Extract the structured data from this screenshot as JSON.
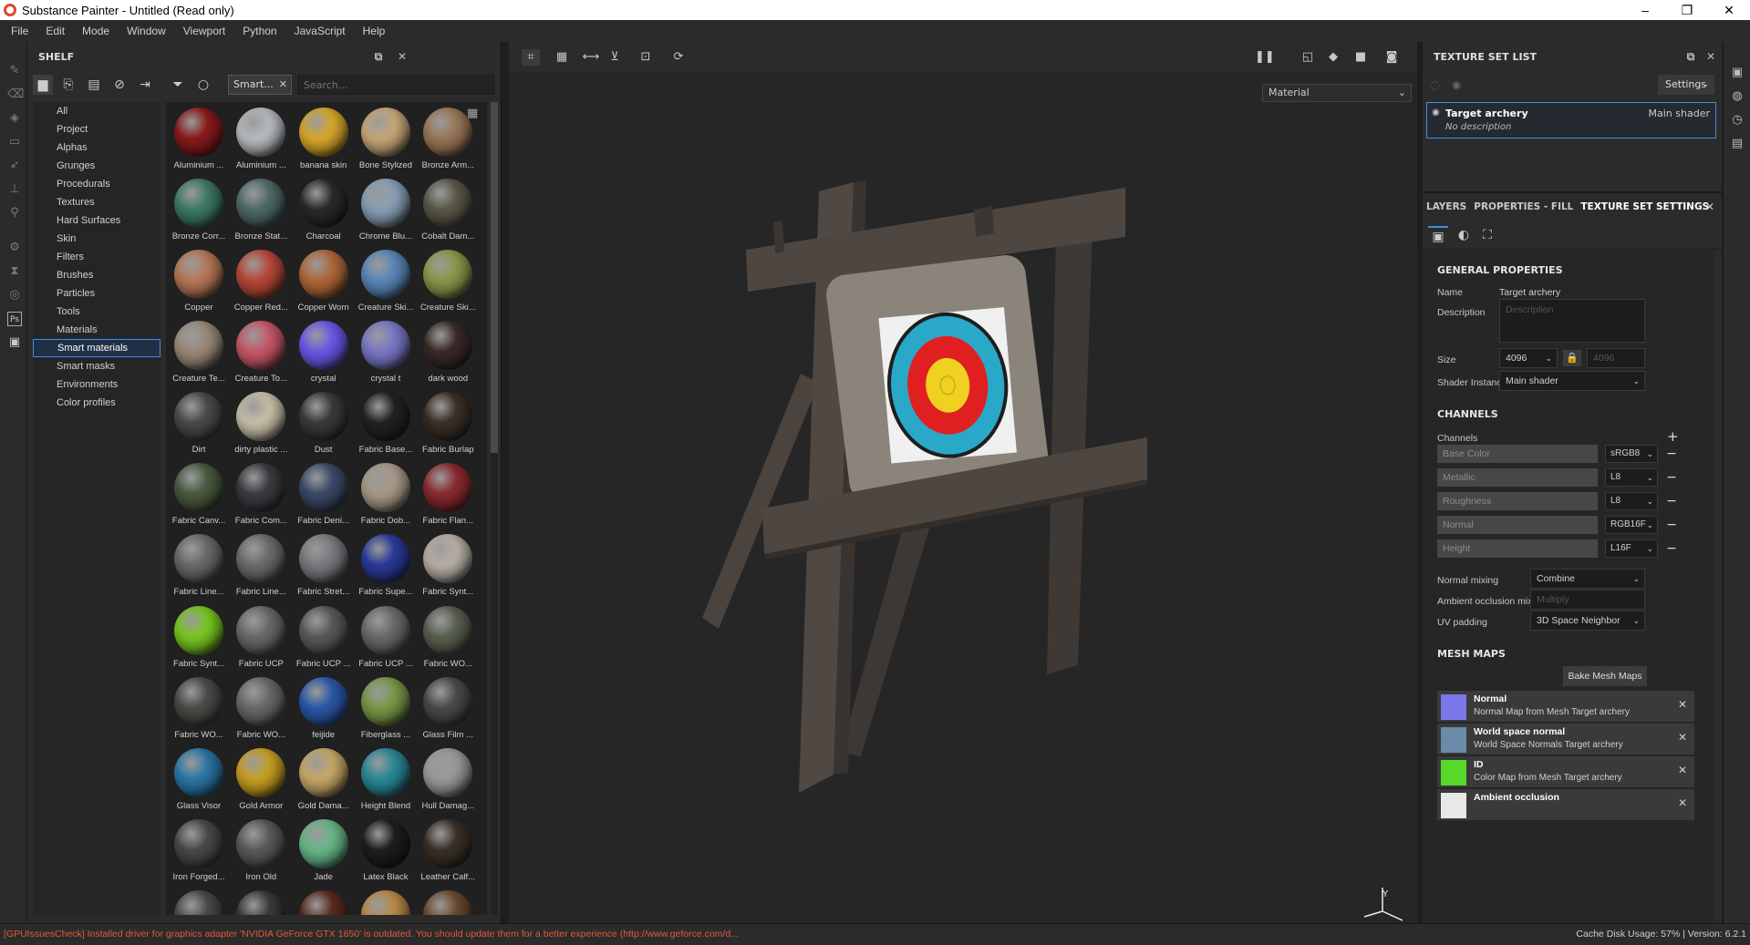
{
  "window": {
    "title": "Substance Painter - Untitled (Read only)",
    "controls": [
      "–",
      "❐",
      "✕"
    ]
  },
  "menu": [
    "File",
    "Edit",
    "Mode",
    "Window",
    "Viewport",
    "Python",
    "JavaScript",
    "Help"
  ],
  "shelf": {
    "title": "SHELF",
    "filter_tag": "Smart...",
    "search_placeholder": "Search...",
    "categories": [
      {
        "label": "All",
        "selected": false
      },
      {
        "label": "Project",
        "selected": false
      },
      {
        "label": "Alphas",
        "selected": false
      },
      {
        "label": "Grunges",
        "selected": false
      },
      {
        "label": "Procedurals",
        "selected": false
      },
      {
        "label": "Textures",
        "selected": false
      },
      {
        "label": "Hard Surfaces",
        "selected": false
      },
      {
        "label": "Skin",
        "selected": false
      },
      {
        "label": "Filters",
        "selected": false
      },
      {
        "label": "Brushes",
        "selected": false
      },
      {
        "label": "Particles",
        "selected": false
      },
      {
        "label": "Tools",
        "selected": false
      },
      {
        "label": "Materials",
        "selected": false
      },
      {
        "label": "Smart materials",
        "selected": true
      },
      {
        "label": "Smart masks",
        "selected": false
      },
      {
        "label": "Environments",
        "selected": false
      },
      {
        "label": "Color profiles",
        "selected": false
      }
    ],
    "materials": [
      {
        "label": "Aluminium ...",
        "color": "#8a1a1a"
      },
      {
        "label": "Aluminium ...",
        "color": "#b8bcc0"
      },
      {
        "label": "banana skin",
        "color": "#d8a82a"
      },
      {
        "label": "Bone Stylized",
        "color": "#c8a878"
      },
      {
        "label": "Bronze Arm...",
        "color": "#9a7858"
      },
      {
        "label": "Bronze Corr...",
        "color": "#3e7a66"
      },
      {
        "label": "Bronze Stat...",
        "color": "#4e6a6a"
      },
      {
        "label": "Charcoal",
        "color": "#2a2a2a"
      },
      {
        "label": "Chrome Blu...",
        "color": "#8aa0b8"
      },
      {
        "label": "Cobalt Dam...",
        "color": "#5a5848"
      },
      {
        "label": "Copper",
        "color": "#b87858"
      },
      {
        "label": "Copper Red...",
        "color": "#b84838"
      },
      {
        "label": "Copper Worn",
        "color": "#b06838"
      },
      {
        "label": "Creature Ski...",
        "color": "#5a88b8"
      },
      {
        "label": "Creature Ski...",
        "color": "#8a9848"
      },
      {
        "label": "Creature Te...",
        "color": "#9a8a78"
      },
      {
        "label": "Creature To...",
        "color": "#c85868"
      },
      {
        "label": "crystal",
        "color": "#6a58e8"
      },
      {
        "label": "crystal t",
        "color": "#7a78c8"
      },
      {
        "label": "dark wood",
        "color": "#3a2a28"
      },
      {
        "label": "Dirt",
        "color": "#4a4a48"
      },
      {
        "label": "dirty plastic ...",
        "color": "#c8c0a8"
      },
      {
        "label": "Dust",
        "color": "#3a3a38"
      },
      {
        "label": "Fabric Base...",
        "color": "#222222"
      },
      {
        "label": "Fabric Burlap",
        "color": "#3a3028"
      },
      {
        "label": "Fabric Canv...",
        "color": "#4a5a40"
      },
      {
        "label": "Fabric Com...",
        "color": "#3a3c40"
      },
      {
        "label": "Fabric Deni...",
        "color": "#3a4a68"
      },
      {
        "label": "Fabric Dob...",
        "color": "#a89a88"
      },
      {
        "label": "Fabric Flan...",
        "color": "#8a2a30"
      },
      {
        "label": "Fabric Line...",
        "color": "#6a6a6a"
      },
      {
        "label": "Fabric Line...",
        "color": "#6a6c6e"
      },
      {
        "label": "Fabric Stret...",
        "color": "#7a7a80"
      },
      {
        "label": "Fabric Supe...",
        "color": "#2a3a98"
      },
      {
        "label": "Fabric Synt...",
        "color": "#b8b0a8"
      },
      {
        "label": "Fabric Synt...",
        "color": "#78c820"
      },
      {
        "label": "Fabric UCP",
        "color": "#6a6a68"
      },
      {
        "label": "Fabric UCP ...",
        "color": "#5a5a58"
      },
      {
        "label": "Fabric UCP ...",
        "color": "#6a6a6a"
      },
      {
        "label": "Fabric WO...",
        "color": "#5a6050"
      },
      {
        "label": "Fabric WO...",
        "color": "#4a4c48"
      },
      {
        "label": "Fabric WO...",
        "color": "#6a6a68"
      },
      {
        "label": "feijide",
        "color": "#2a58a8"
      },
      {
        "label": "Fiberglass ...",
        "color": "#7a9848"
      },
      {
        "label": "Glass Film ...",
        "color": "#4a4a4a"
      },
      {
        "label": "Glass Visor",
        "color": "#2a78a8"
      },
      {
        "label": "Gold Armor",
        "color": "#c8a020"
      },
      {
        "label": "Gold Dama...",
        "color": "#c8a868"
      },
      {
        "label": "Height Blend",
        "color": "#2a8898"
      },
      {
        "label": "Hull Damag...",
        "color": "#9a9a98"
      },
      {
        "label": "Iron Forged...",
        "color": "#4a4a4c"
      },
      {
        "label": "Iron Old",
        "color": "#5a5a5c"
      },
      {
        "label": "Jade",
        "color": "#68b888"
      },
      {
        "label": "Latex Black",
        "color": "#1e1e1e"
      },
      {
        "label": "Leather Calf...",
        "color": "#3a3028"
      },
      {
        "label": "",
        "color": "#4a4a4a"
      },
      {
        "label": "",
        "color": "#3a3a3a"
      },
      {
        "label": "",
        "color": "#5a2a20"
      },
      {
        "label": "",
        "color": "#b88a48"
      },
      {
        "label": "",
        "color": "#6a4a30"
      }
    ]
  },
  "viewport": {
    "mode": "Material"
  },
  "texture_set_list": {
    "title": "TEXTURE SET LIST",
    "settings_label": "Settings",
    "item": {
      "name": "Target archery",
      "shader": "Main shader",
      "description": "No description"
    }
  },
  "properties": {
    "tabs": [
      "LAYERS",
      "PROPERTIES - FILL",
      "TEXTURE SET SETTINGS"
    ],
    "active_tab": "TEXTURE SET SETTINGS",
    "general": {
      "title": "GENERAL PROPERTIES",
      "name_label": "Name",
      "name_value": "Target archery",
      "description_label": "Description",
      "description_placeholder": "Description",
      "size_label": "Size",
      "size_value": "4096",
      "size_value_2": "4096",
      "shader_label": "Shader Instance",
      "shader_value": "Main shader"
    },
    "channels": {
      "title": "CHANNELS",
      "label": "Channels",
      "items": [
        {
          "name": "Base Color",
          "format": "sRGB8"
        },
        {
          "name": "Metallic",
          "format": "L8"
        },
        {
          "name": "Roughness",
          "format": "L8"
        },
        {
          "name": "Normal",
          "format": "RGB16F"
        },
        {
          "name": "Height",
          "format": "L16F"
        }
      ],
      "normal_mixing_label": "Normal mixing",
      "normal_mixing_value": "Combine",
      "ao_mixing_label": "Ambient occlusion mixing",
      "ao_mixing_value": "Multiply",
      "uv_padding_label": "UV padding",
      "uv_padding_value": "3D Space Neighbor"
    },
    "mesh_maps": {
      "title": "MESH MAPS",
      "bake_button": "Bake Mesh Maps",
      "items": [
        {
          "title": "Normal",
          "subtitle": "Normal Map from Mesh Target archery",
          "color": "#7a78e8"
        },
        {
          "title": "World space normal",
          "subtitle": "World Space Normals Target archery",
          "color": "#6a8aa8"
        },
        {
          "title": "ID",
          "subtitle": "Color Map from Mesh Target archery",
          "color": "#58d828"
        },
        {
          "title": "Ambient occlusion",
          "subtitle": "",
          "color": "#e8e8e8"
        }
      ]
    }
  },
  "status": {
    "warning": "[GPUIssuesCheck] Installed driver for graphics adapter 'NVIDIA GeForce GTX 1650' is outdated. You should update them for a better experience (http://www.geforce.com/d...",
    "right": "Cache Disk Usage:    57%  |  Version: 6.2.1"
  }
}
